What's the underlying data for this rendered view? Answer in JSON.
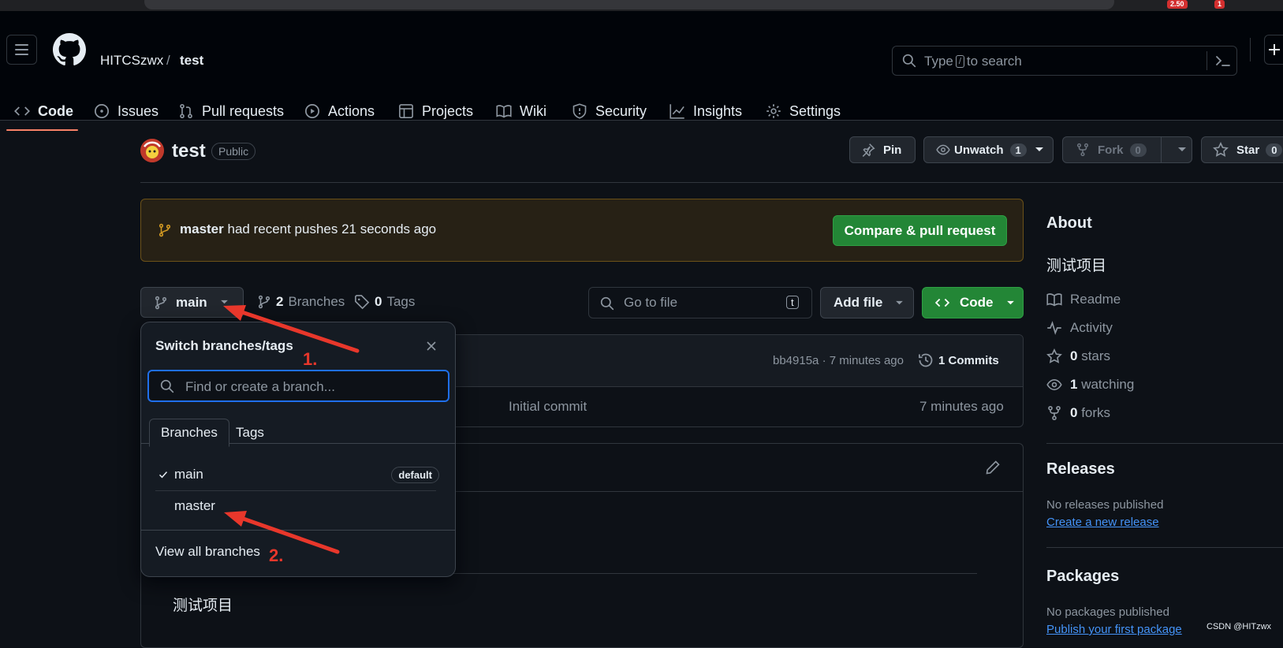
{
  "header": {
    "owner": "HITCSzwx",
    "separator": "/",
    "repo": "test",
    "search_prefix": "Type",
    "search_key": "/",
    "search_suffix": "to search"
  },
  "tabs": [
    {
      "label": "Code",
      "icon": "code-icon",
      "active": true
    },
    {
      "label": "Issues",
      "icon": "issue-opened-icon"
    },
    {
      "label": "Pull requests",
      "icon": "git-pull-request-icon"
    },
    {
      "label": "Actions",
      "icon": "play-icon"
    },
    {
      "label": "Projects",
      "icon": "table-icon"
    },
    {
      "label": "Wiki",
      "icon": "book-icon"
    },
    {
      "label": "Security",
      "icon": "shield-icon"
    },
    {
      "label": "Insights",
      "icon": "graph-icon"
    },
    {
      "label": "Settings",
      "icon": "gear-icon"
    }
  ],
  "repo_header": {
    "name": "test",
    "visibility": "Public",
    "pin_label": "Pin",
    "watch_label": "Unwatch",
    "watch_count": "1",
    "fork_label": "Fork",
    "fork_count": "0",
    "star_label": "Star",
    "star_count": "0"
  },
  "banner": {
    "branch": "master",
    "message": "had recent pushes 21 seconds ago",
    "button": "Compare & pull request"
  },
  "branch_bar": {
    "current_branch": "main",
    "branches_count": "2",
    "branches_label": "Branches",
    "tags_count": "0",
    "tags_label": "Tags",
    "goto_placeholder": "Go to file",
    "goto_key": "t",
    "add_file": "Add file",
    "code_button": "Code"
  },
  "commit_bar": {
    "hash": "bb4915a",
    "age": "7 minutes ago",
    "commits": "1 Commits"
  },
  "file_row": {
    "message": "Initial commit",
    "age": "7 minutes ago"
  },
  "readme": {
    "body": "测试项目"
  },
  "sidebar": {
    "about_title": "About",
    "description": "测试项目",
    "readme": "Readme",
    "activity": "Activity",
    "stars_count": "0",
    "stars_label": "stars",
    "watching_count": "1",
    "watching_label": "watching",
    "forks_count": "0",
    "forks_label": "forks",
    "releases_title": "Releases",
    "releases_empty": "No releases published",
    "releases_link": "Create a new release",
    "packages_title": "Packages",
    "packages_empty": "No packages published",
    "packages_link": "Publish your first package"
  },
  "dropdown": {
    "title": "Switch branches/tags",
    "placeholder": "Find or create a branch...",
    "tab_branches": "Branches",
    "tab_tags": "Tags",
    "items": [
      {
        "name": "main",
        "checked": true,
        "badge": "default"
      },
      {
        "name": "master",
        "checked": false,
        "badge": ""
      }
    ],
    "view_all": "View all branches"
  },
  "annotations": {
    "step1": "1.",
    "step2": "2.",
    "arrow_color": "#e8372b"
  },
  "browser": {
    "badge1": "2.50",
    "badge2": "1"
  },
  "watermark": "CSDN @HITzwx",
  "colors": {
    "background": "#0d1117",
    "accent_green": "#238636",
    "link_blue": "#4493f8",
    "underline_orange": "#f78166"
  }
}
